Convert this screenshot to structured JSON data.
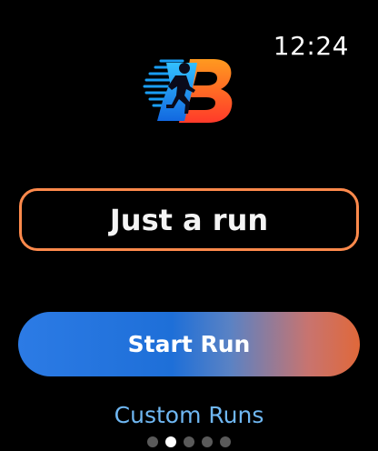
{
  "status_bar": {
    "time": "12:24"
  },
  "logo": {
    "icon": "runner-b-logo",
    "letter": "B",
    "colors": {
      "runner": "#1a9ef5",
      "speed_lines": "#1a9ef5",
      "letter_top": "#ff9a1f",
      "letter_bottom": "#ff3a2a"
    }
  },
  "workout_selector": {
    "label": "Just a run",
    "border_color": "#ff8a4c"
  },
  "start_button": {
    "label": "Start Run",
    "gradient": [
      "#2c7be5",
      "#e0683a"
    ]
  },
  "custom_runs": {
    "label": "Custom Runs",
    "color": "#6fb7f2"
  },
  "pagination": {
    "total_pages": 5,
    "current_page": 2
  }
}
